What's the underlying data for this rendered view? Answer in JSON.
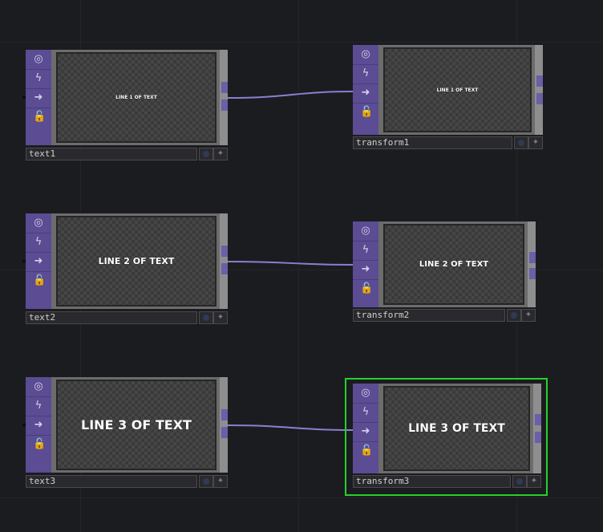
{
  "nodes": [
    {
      "name": "text1",
      "preview": "LINE 1 OF TEXT"
    },
    {
      "name": "transform1",
      "preview": "LINE 1 OF TEXT"
    },
    {
      "name": "text2",
      "preview": "LINE 2 OF TEXT"
    },
    {
      "name": "transform2",
      "preview": "LINE 2 OF TEXT"
    },
    {
      "name": "text3",
      "preview": "LINE 3 OF TEXT"
    },
    {
      "name": "transform3",
      "preview": "LINE 3 OF TEXT"
    }
  ],
  "icons": [
    "viewer-toggle-icon",
    "cook-icon",
    "bypass-arrow-icon",
    "lock-icon"
  ],
  "colors": {
    "background": "#1b1c20",
    "operator_strip": "#5b4c93",
    "wire": "#8a7fd0",
    "selection": "#27d02b"
  },
  "selected_node": "transform3"
}
